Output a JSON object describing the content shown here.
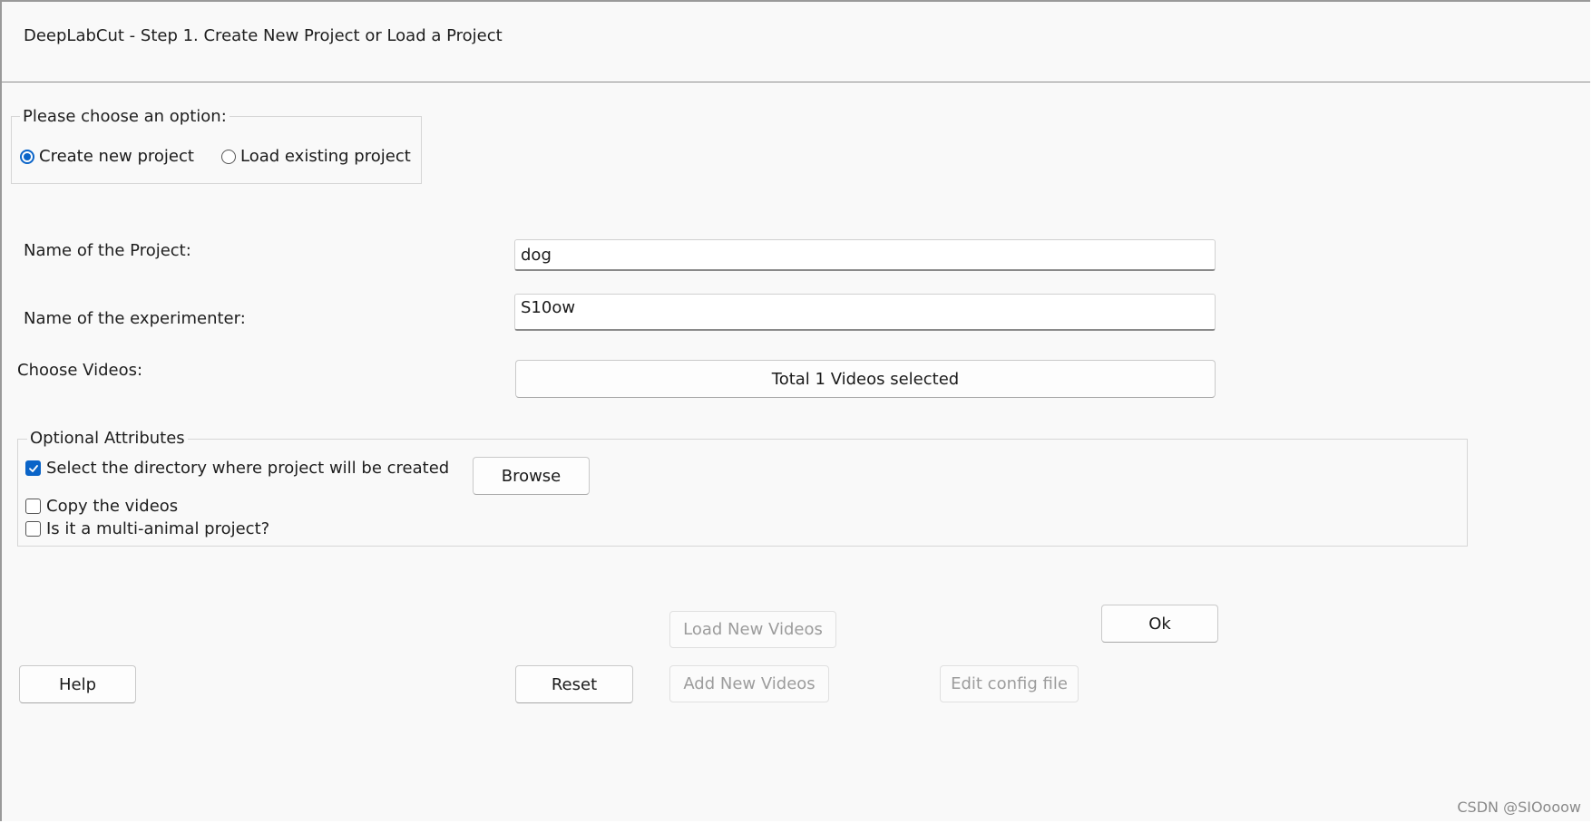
{
  "window": {
    "title": "DeepLabCut - Step 1. Create New Project or Load a Project"
  },
  "option_group": {
    "label": "Please choose an option:",
    "options": [
      {
        "label": "Create new project",
        "selected": true
      },
      {
        "label": "Load existing project",
        "selected": false
      }
    ]
  },
  "form": {
    "project_name_label": "Name of the Project:",
    "project_name_value": "dog",
    "experimenter_label": "Name of the experimenter:",
    "experimenter_value": "S10ow",
    "videos_label": "Choose Videos:",
    "videos_button": "Total 1 Videos selected"
  },
  "optional": {
    "label": "Optional Attributes",
    "select_dir_label": "Select the directory where project will be created",
    "select_dir_checked": true,
    "browse_button": "Browse",
    "copy_videos_label": "Copy the videos",
    "copy_videos_checked": false,
    "multi_animal_label": "Is it a multi-animal project?",
    "multi_animal_checked": false
  },
  "buttons": {
    "load_new_videos": "Load New Videos",
    "ok": "Ok",
    "help": "Help",
    "reset": "Reset",
    "add_new_videos": "Add New Videos",
    "edit_config": "Edit config file"
  },
  "watermark": "CSDN @SIOooow",
  "colors": {
    "accent": "#0a64c8",
    "background": "#f9f9f9",
    "disabled_text": "#9c9c9c"
  }
}
